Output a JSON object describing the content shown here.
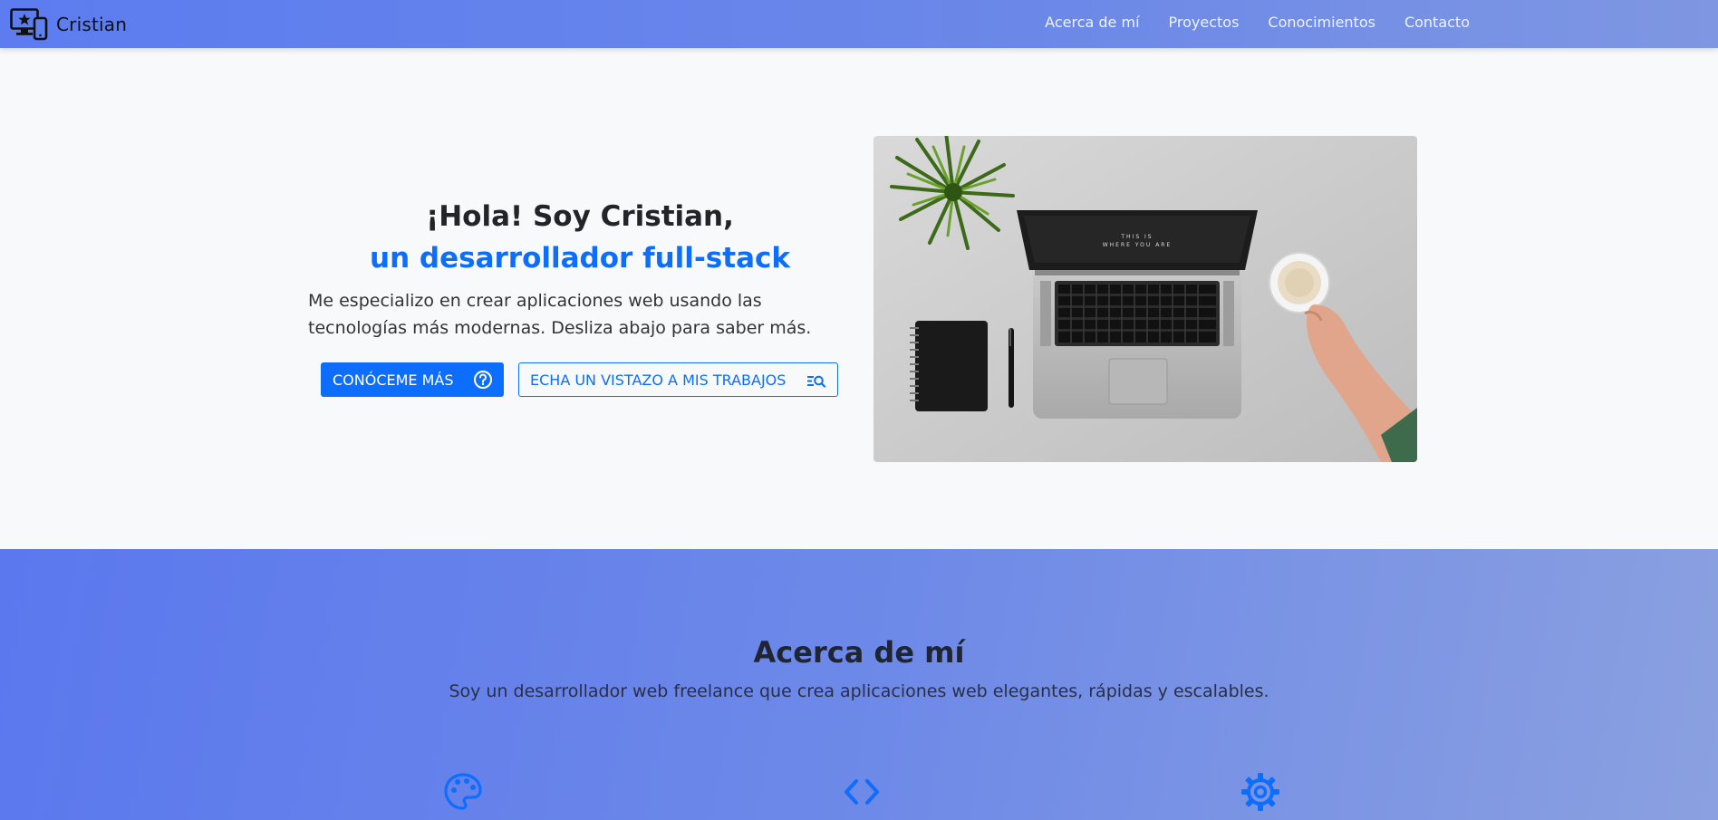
{
  "navbar": {
    "brand": "Cristian",
    "brand_icon": "devices-star-icon",
    "links": [
      "Acerca de mí",
      "Proyectos",
      "Conocimientos",
      "Contacto"
    ]
  },
  "hero": {
    "title_line1": "¡Hola! Soy Cristian,",
    "title_line2": "un desarrollador full-stack",
    "description": "Me especializo en crear aplicaciones web usando las tecnologías más modernas. Desliza abajo para saber más.",
    "primary_button": "CONÓCEME MÁS",
    "primary_button_icon": "question-circle-icon",
    "secondary_button": "ECHA UN VISTAZO A MIS TRABAJOS",
    "secondary_button_icon": "search-list-icon",
    "image_screen_text_line1": "THIS IS",
    "image_screen_text_line2": "WHERE YOU ARE"
  },
  "about": {
    "title": "Acerca de mí",
    "subtitle": "Soy un desarrollador web freelance que crea aplicaciones web elegantes, rápidas y escalables.",
    "feature_icons": [
      "palette-icon",
      "code-icon",
      "gear-icon"
    ]
  },
  "colors": {
    "accent": "#0d6efd",
    "navbar_gradient_start": "#5c7cf0",
    "navbar_gradient_end": "#7f97e2",
    "hero_bg": "#f8f9fa",
    "title_dark": "#212529"
  }
}
